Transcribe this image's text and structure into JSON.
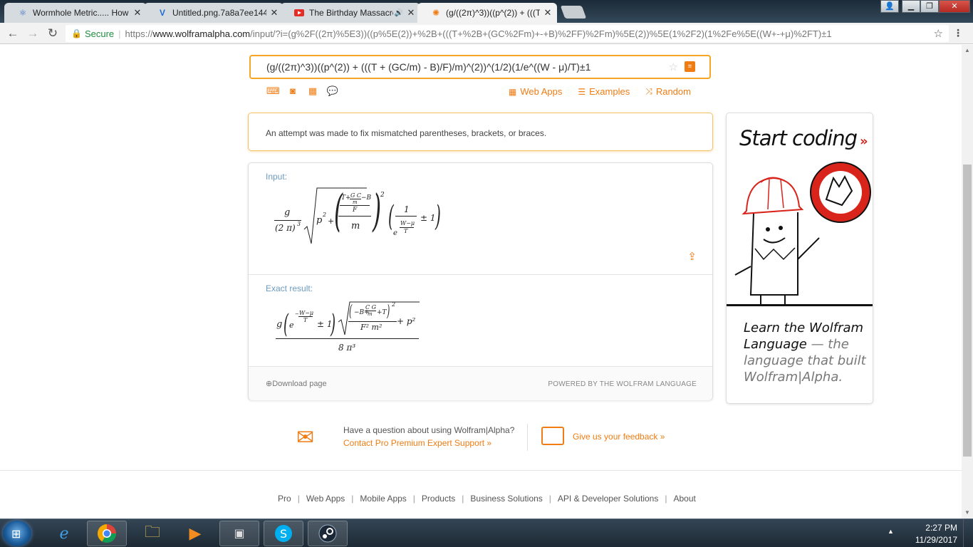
{
  "tabs": [
    {
      "title": "Wormhole Metric..... How",
      "icon": "atom-icon"
    },
    {
      "title": "Untitled.png.7a8a7ee144",
      "icon": "v-icon"
    },
    {
      "title": "The Birthday Massacre",
      "icon": "youtube-icon"
    },
    {
      "title": "(g/((2π)^3))((p^(2)) + (((T",
      "icon": "wolfram-icon"
    }
  ],
  "address": {
    "secure_label": "Secure",
    "url_scheme": "https://",
    "url_host": "www.wolframalpha.com",
    "url_path": "/input/?i=(g%2F((2π)%5E3))((p%5E(2))+%2B+(((T+%2B+(GC%2Fm)+-+B)%2FF)%2Fm)%5E(2))%5E(1%2F2)(1%2Fe%5E((W+-+μ)%2FT)±1"
  },
  "search": {
    "query": "(g/((2π)^3))((p^(2)) + (((T + (GC/m) - B)/F)/m)^(2))^(1/2)(1/e^((W - μ)/T)±1"
  },
  "top_links": [
    "Web Apps",
    "Examples",
    "Random"
  ],
  "notice": "An attempt was made to fix mismatched parentheses, brackets, or braces.",
  "pods": {
    "input_title": "Input:",
    "result_title": "Exact result:",
    "download": "Download page",
    "powered": "POWERED BY THE WOLFRAM LANGUAGE"
  },
  "math": {
    "g": "g",
    "two_pi": "(2 π)",
    "three": "3",
    "p": "p",
    "two": "2",
    "plus": "+",
    "T": "T",
    "GC": "G C",
    "m": "m",
    "minus_B": "−B",
    "F": "F",
    "one": "1",
    "e": "e",
    "W_minus_mu": "W−μ",
    "pm1": "± 1",
    "minus_B_plus": "−B+",
    "CG": "C G",
    "plus_T": "+T",
    "F2m2": "F² m²",
    "p2": "+ p²",
    "eight_pi3": "8 π³"
  },
  "ad": {
    "headline": "Start coding",
    "arrow": "»",
    "line1": "Learn the Wolfram",
    "line2a": "Language",
    "line2b": "— the",
    "line3": "language that built",
    "line4": "Wolfram|Alpha."
  },
  "help": {
    "question": "Have a question about using Wolfram|Alpha?",
    "contact": "Contact Pro Premium Expert Support »",
    "feedback": "Give us your feedback »"
  },
  "footer": [
    "Pro",
    "Web Apps",
    "Mobile Apps",
    "Products",
    "Business Solutions",
    "API & Developer Solutions",
    "About"
  ],
  "clock": {
    "time": "2:27 PM",
    "date": "11/29/2017"
  },
  "colors": {
    "accent": "#f07c14",
    "pod_title": "#6c9bc0",
    "secure": "#1e8e3e"
  }
}
